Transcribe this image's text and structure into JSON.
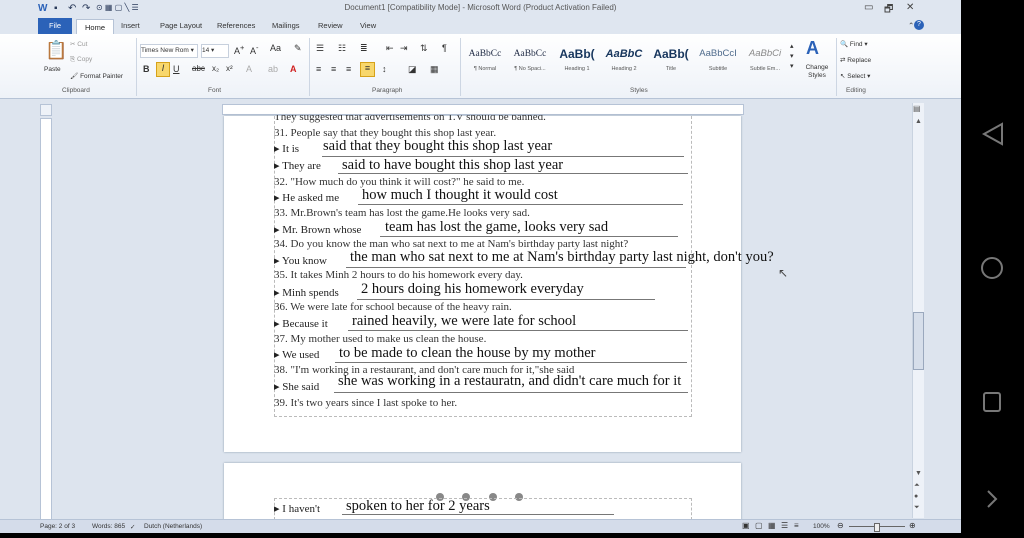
{
  "window": {
    "title": "Document1 [Compatibility Mode] - Microsoft Word (Product Activation Failed)",
    "qat_icons": [
      "word-logo-icon",
      "save-icon",
      "undo-icon",
      "redo-icon"
    ],
    "minimize": "▭",
    "restore": "🗗",
    "close": "✕",
    "ribbon_minimize": "⌃",
    "help": "?"
  },
  "tabs": [
    "File",
    "Home",
    "Insert",
    "Page Layout",
    "References",
    "Mailings",
    "Review",
    "View"
  ],
  "ribbon": {
    "clipboard": {
      "paste": "Paste",
      "cut": "Cut",
      "copy": "Copy",
      "format_painter": "Format Painter",
      "label": "Clipboard"
    },
    "font": {
      "name": "Times New Rom",
      "size": "14",
      "label": "Font"
    },
    "paragraph": {
      "label": "Paragraph"
    },
    "styles": {
      "label": "Styles",
      "items": [
        {
          "preview": "AaBbCc",
          "name": "¶ Normal"
        },
        {
          "preview": "AaBbCc",
          "name": "¶ No Spaci..."
        },
        {
          "preview": "AaBb(",
          "name": "Heading 1"
        },
        {
          "preview": "AaBbC",
          "name": "Heading 2"
        },
        {
          "preview": "AaBb(",
          "name": "Title"
        },
        {
          "preview": "AaBbCcI",
          "name": "Subtitle"
        },
        {
          "preview": "AaBbCi",
          "name": "Subtle Em..."
        }
      ],
      "change_styles": "Change Styles"
    },
    "editing": {
      "find": "Find",
      "replace": "Replace",
      "select": "Select",
      "label": "Editing"
    }
  },
  "document": {
    "cut_top_line": "They suggested that advertisements on T.V should be banned.",
    "q31": "31. People say that they bought this shop last year.",
    "q31a_stem": "It is",
    "q31a_answer": "said that they bought this shop last year",
    "q31b_stem": "They are",
    "q31b_answer": "said to have bought this shop last year",
    "q32": "32. \"How much do you think it will cost?\" he said to me.",
    "q32_stem": "He asked me",
    "q32_answer": "how much I thought it would cost",
    "q33": "33. Mr.Brown's team has lost the game.He looks very sad.",
    "q33_stem": "Mr. Brown whose",
    "q33_answer": "team has lost the game, looks very sad",
    "q34": "34. Do you know the man who sat next to me at Nam's birthday party last night?",
    "q34_stem": "You know",
    "q34_answer": "the man who sat next to me at Nam's birthday party last night, don't you?",
    "q35": "35. It takes Minh 2 hours to do his homework every day.",
    "q35_stem": "Minh spends",
    "q35_answer": "2 hours doing his homework everyday",
    "q36": "36. We were late for school because of the heavy rain.",
    "q36_stem": "Because it",
    "q36_answer": "rained heavily, we were late for school",
    "q37": "37. My mother used to make us clean the house.",
    "q37_stem": "We used",
    "q37_answer": "to be made to clean the house by my mother",
    "q38": "38. \"I'm working in a restaurant, and don't care much for it,\"she said",
    "q38_stem": "She said",
    "q38_answer": "she was working in a restauratn, and didn't care much for it",
    "q39": "39. It's two years since I last spoke to her.",
    "q39_stem": "I haven't",
    "q39_answer": "spoken to her for 2 years"
  },
  "status": {
    "page": "Page: 2 of 3",
    "words": "Words: 865",
    "language": "Dutch (Netherlands)",
    "zoom": "100%"
  },
  "android_nav": [
    "back-icon",
    "home-icon",
    "recents-icon",
    "forward-icon"
  ]
}
